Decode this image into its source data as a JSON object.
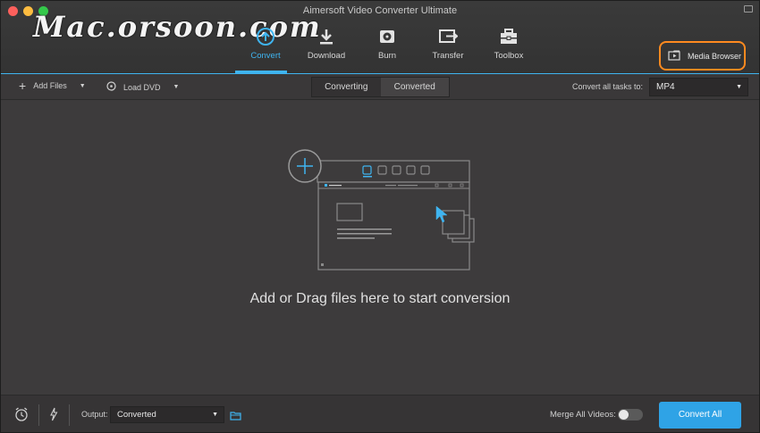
{
  "window": {
    "title": "Aimersoft Video Converter Ultimate"
  },
  "watermark": "Mac.orsoon.com",
  "nav": {
    "tabs": [
      {
        "label": "Convert",
        "icon": "convert-icon",
        "active": true
      },
      {
        "label": "Download",
        "icon": "download-icon",
        "active": false
      },
      {
        "label": "Burn",
        "icon": "burn-disc-icon",
        "active": false
      },
      {
        "label": "Transfer",
        "icon": "transfer-icon",
        "active": false
      },
      {
        "label": "Toolbox",
        "icon": "toolbox-icon",
        "active": false
      }
    ],
    "media_browser": "Media Browser"
  },
  "subbar": {
    "add_files": "Add Files",
    "load_dvd": "Load DVD",
    "segments": [
      "Converting",
      "Converted"
    ],
    "active_segment": "Converting",
    "convert_all_label": "Convert all tasks to:",
    "format": "MP4"
  },
  "main": {
    "drop_text": "Add or Drag files here to start conversion"
  },
  "bottom": {
    "output_label": "Output:",
    "output_value": "Converted",
    "merge_label": "Merge All Videos:",
    "merge_enabled": false,
    "convert_all_button": "Convert All"
  },
  "colors": {
    "accent": "#3fb4f0",
    "highlight_border": "#ff8a1f",
    "button": "#2fa3e6",
    "background": "#3d3b3c"
  }
}
